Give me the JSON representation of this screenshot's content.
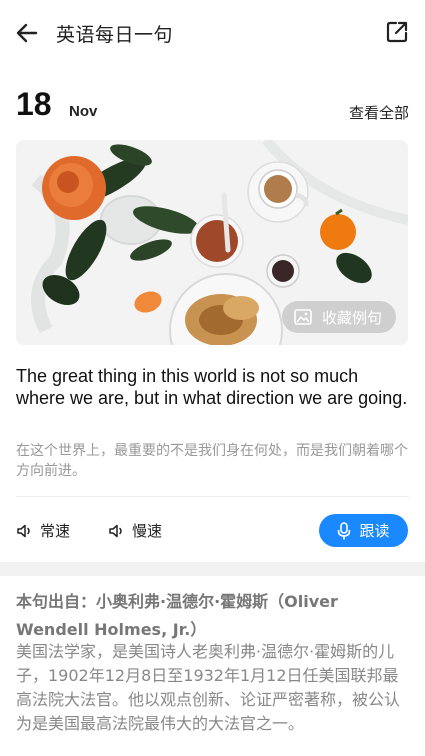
{
  "header": {
    "title": "英语每日一句"
  },
  "date": {
    "day": "18",
    "month": "Nov",
    "view_all": "查看全部"
  },
  "photo": {
    "favorite_label": "收藏例句"
  },
  "sentence": {
    "english": "The great thing in this world is not so much where we are, but in what direction we are going.",
    "chinese": "在这个世界上，最重要的不是我们身在何处，而是我们朝着哪个方向前进。"
  },
  "controls": {
    "normal_speed": "常速",
    "slow_speed": "慢速",
    "read_along": "跟读",
    "accent": "#1a88ff"
  },
  "source": {
    "heading": "本句出自：小奥利弗·温德尔·霍姆斯（Oliver Wendell Holmes, Jr.）",
    "description": "美国法学家，是美国诗人老奥利弗·温德尔·霍姆斯的儿子，1902年12月8日至1932年1月12日任美国联邦最高法院大法官。他以观点创新、论证严密著称，被公认为是美国最高法院最伟大的大法官之一。"
  },
  "icons": {
    "back": "arrow-left-icon",
    "share": "share-external-icon",
    "image": "image-icon",
    "speaker": "speaker-icon",
    "microphone": "microphone-icon"
  }
}
